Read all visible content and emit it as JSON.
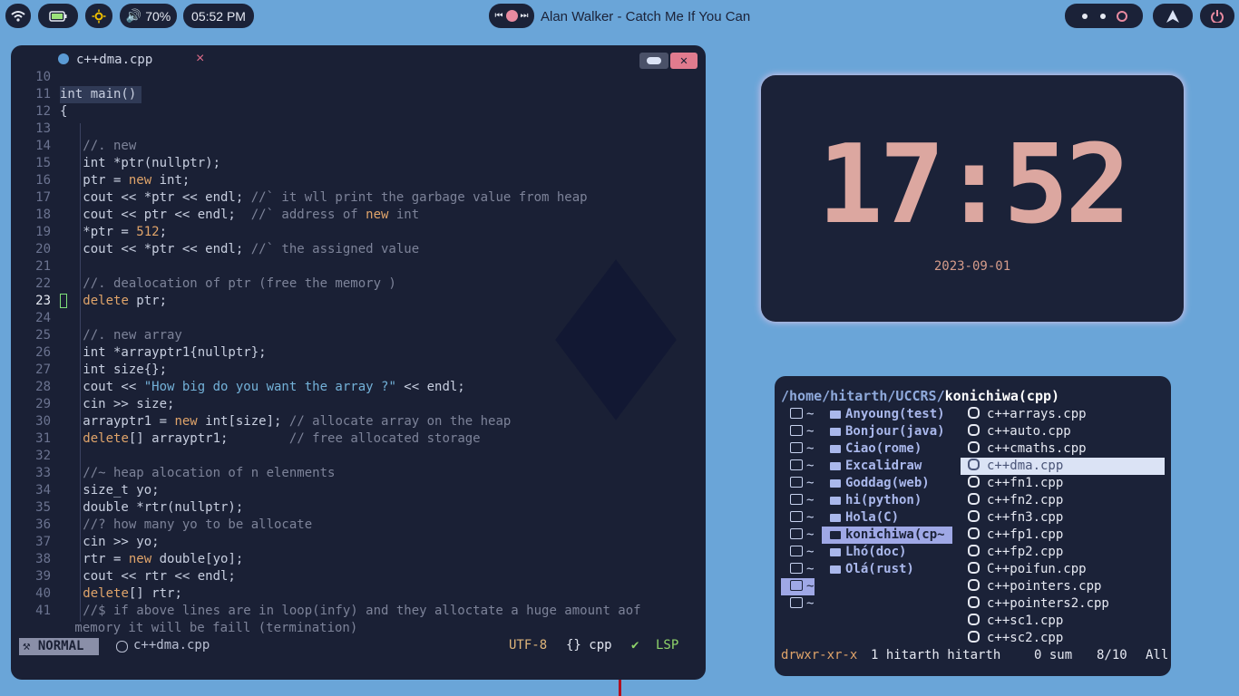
{
  "topbar": {
    "volume": "70%",
    "time": "05:52 PM",
    "now_playing": "Alan Walker - Catch Me If You Can"
  },
  "editor": {
    "tab_title": "c++dma.cpp",
    "tab_close": "×",
    "code_lines": [
      {
        "n": "10",
        "t": ""
      },
      {
        "n": "11",
        "t": "int main()"
      },
      {
        "n": "12",
        "t": "{"
      },
      {
        "n": "13",
        "t": ""
      },
      {
        "n": "14",
        "t": "   //. new"
      },
      {
        "n": "15",
        "t": "   int *ptr(nullptr);"
      },
      {
        "n": "16",
        "t": "   ptr = new int;"
      },
      {
        "n": "17",
        "t": "   cout << *ptr << endl; //` it wll print the garbage value from heap"
      },
      {
        "n": "18",
        "t": "   cout << ptr << endl;  //` address of new int"
      },
      {
        "n": "19",
        "t": "   *ptr = 512;"
      },
      {
        "n": "20",
        "t": "   cout << *ptr << endl; //` the assigned value"
      },
      {
        "n": "21",
        "t": ""
      },
      {
        "n": "22",
        "t": "   //. dealocation of ptr (free the memory )"
      },
      {
        "n": "23",
        "t": "   delete ptr;"
      },
      {
        "n": "24",
        "t": ""
      },
      {
        "n": "25",
        "t": "   //. new array"
      },
      {
        "n": "26",
        "t": "   int *arrayptr1{nullptr};"
      },
      {
        "n": "27",
        "t": "   int size{};"
      },
      {
        "n": "28",
        "t": "   cout << \"How big do you want the array ?\" << endl;"
      },
      {
        "n": "29",
        "t": "   cin >> size;"
      },
      {
        "n": "30",
        "t": "   arrayptr1 = new int[size]; // allocate array on the heap"
      },
      {
        "n": "31",
        "t": "   delete[] arrayptr1;        // free allocated storage"
      },
      {
        "n": "32",
        "t": ""
      },
      {
        "n": "33",
        "t": "   //~ heap alocation of n elenments"
      },
      {
        "n": "34",
        "t": "   size_t yo;"
      },
      {
        "n": "35",
        "t": "   double *rtr(nullptr);"
      },
      {
        "n": "36",
        "t": "   //? how many yo to be allocate"
      },
      {
        "n": "37",
        "t": "   cin >> yo;"
      },
      {
        "n": "38",
        "t": "   rtr = new double[yo];"
      },
      {
        "n": "39",
        "t": "   cout << rtr << endl;"
      },
      {
        "n": "40",
        "t": "   delete[] rtr;"
      },
      {
        "n": "41",
        "t": "   //$ if above lines are in loop(infy) and they alloctate a huge amount aof"
      },
      {
        "n": "",
        "t": " memory it will be faill (termination)"
      }
    ],
    "status": {
      "mode": "NORMAL",
      "file": "c++dma.cpp",
      "encoding": "UTF-8",
      "filetype": "{} cpp",
      "lsp": "LSP"
    }
  },
  "clock_widget": {
    "time": "17:52",
    "date": "2023-09-01"
  },
  "file_manager": {
    "path_prefix": "/home/hitarth/UCCRS/",
    "path_current": "konichiwa(cpp)",
    "bookmarks": [
      "~",
      "~",
      "~",
      "~",
      "~",
      "~",
      "~",
      "~",
      "~",
      "~",
      "~",
      "~"
    ],
    "folders": [
      "Anyoung(test)",
      "Bonjour(java)",
      "Ciao(rome)",
      "Excalidraw",
      "Goddag(web)",
      "hi(python)",
      "Hola(C)",
      "konichiwa(cp~",
      "Lhó(doc)",
      "Olá(rust)"
    ],
    "files": [
      "c++arrays.cpp",
      "c++auto.cpp",
      "c++cmaths.cpp",
      "c++dma.cpp",
      "c++fn1.cpp",
      "c++fn2.cpp",
      "c++fn3.cpp",
      "c++fp1.cpp",
      "c++fp2.cpp",
      "C++poifun.cpp",
      "c++pointers.cpp",
      "c++pointers2.cpp",
      "c++sc1.cpp",
      "c++sc2.cpp"
    ],
    "status": {
      "perms": "drwxr-xr-x",
      "info": "1 hitarth hitarth",
      "sum": "0 sum",
      "pos": "8/10",
      "scope": "All"
    }
  }
}
